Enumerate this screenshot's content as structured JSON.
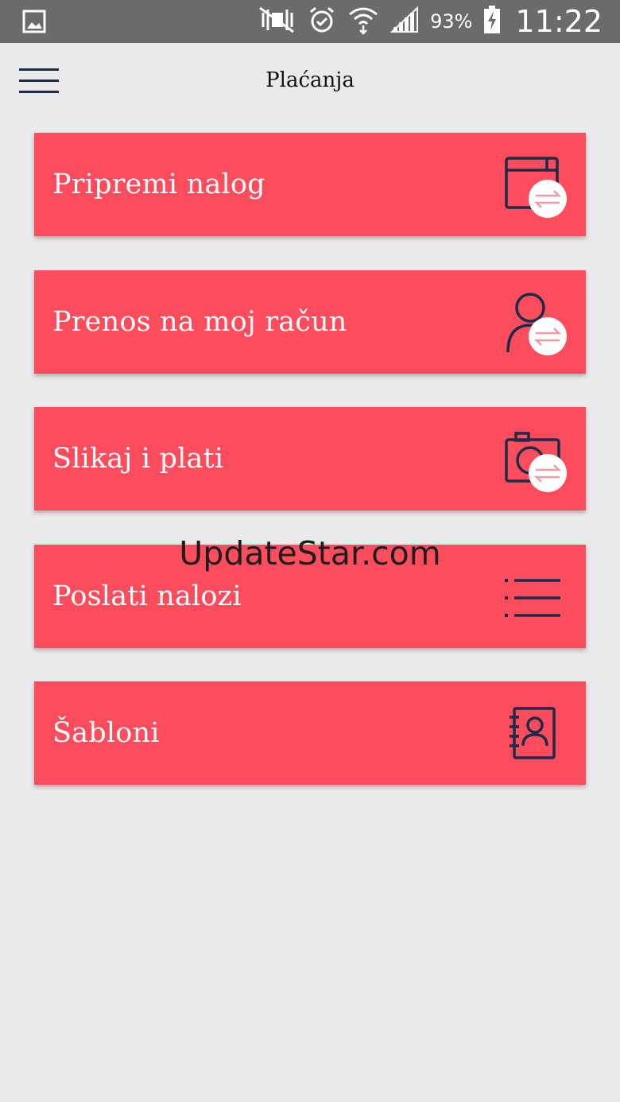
{
  "status_bar": {
    "battery_percent": "93%",
    "time": "11:22",
    "icons": [
      "gallery-icon",
      "mute-icon",
      "alarm-icon",
      "wifi-icon",
      "signal-icon",
      "battery-charging-icon"
    ]
  },
  "app_bar": {
    "title": "Plaćanja",
    "menu_icon": "hamburger-menu-icon"
  },
  "menu_items": [
    {
      "label": "Pripremi nalog",
      "icon": "payment-order-transfer-icon"
    },
    {
      "label": "Prenos na moj račun",
      "icon": "person-transfer-icon"
    },
    {
      "label": "Slikaj i plati",
      "icon": "camera-transfer-icon"
    },
    {
      "label": "Poslati nalozi",
      "icon": "list-icon"
    },
    {
      "label": "Šabloni",
      "icon": "address-book-icon"
    }
  ],
  "watermark": "UpdateStar.com",
  "colors": {
    "card": "#fd4c5c",
    "icon_dark": "#1c2b4a",
    "background": "#e9eaec",
    "status_bar": "#6b6b6b"
  }
}
